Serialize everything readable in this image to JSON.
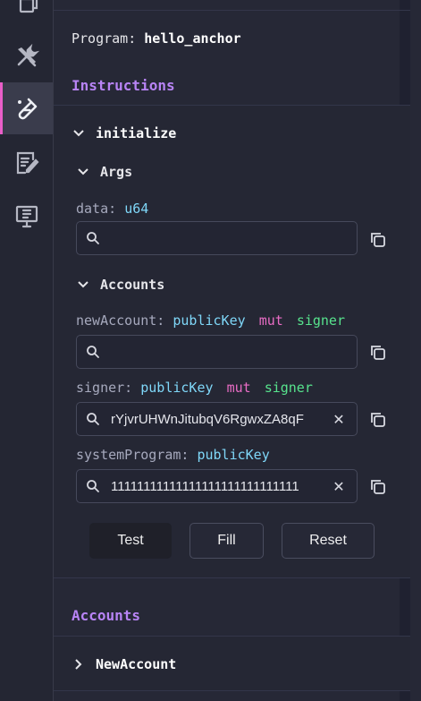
{
  "program": {
    "label": "Program:",
    "name": "hello_anchor"
  },
  "instructions": {
    "title": "Instructions",
    "name": "initialize",
    "args": {
      "title": "Args",
      "data": {
        "name": "data:",
        "type": "u64",
        "value": ""
      }
    },
    "accounts": {
      "title": "Accounts",
      "newAccount": {
        "name": "newAccount:",
        "type": "publicKey",
        "mut": "mut",
        "signer": "signer",
        "value": ""
      },
      "signer": {
        "name": "signer:",
        "type": "publicKey",
        "mut": "mut",
        "signer": "signer",
        "value": "rYjvrUHWnJitubqV6RgwxZA8qF"
      },
      "systemProgram": {
        "name": "systemProgram:",
        "type": "publicKey",
        "value": "11111111111111111111111111111"
      }
    },
    "buttons": {
      "test": "Test",
      "fill": "Fill",
      "reset": "Reset"
    }
  },
  "accounts_section": {
    "title": "Accounts",
    "item": "NewAccount"
  },
  "icons": {
    "sidebar": [
      "files-icon",
      "tools-icon",
      "test-tube-icon",
      "notes-edit-icon",
      "presentation-icon"
    ],
    "search": "search-icon",
    "copy": "copy-icon",
    "clear": "close-icon"
  },
  "colors": {
    "accent_purple": "#b884f5",
    "type_blue": "#7fd7f8",
    "mut_pink": "#e96cc5",
    "signer_green": "#57e38d",
    "active_indicator": "#e95ec8"
  }
}
